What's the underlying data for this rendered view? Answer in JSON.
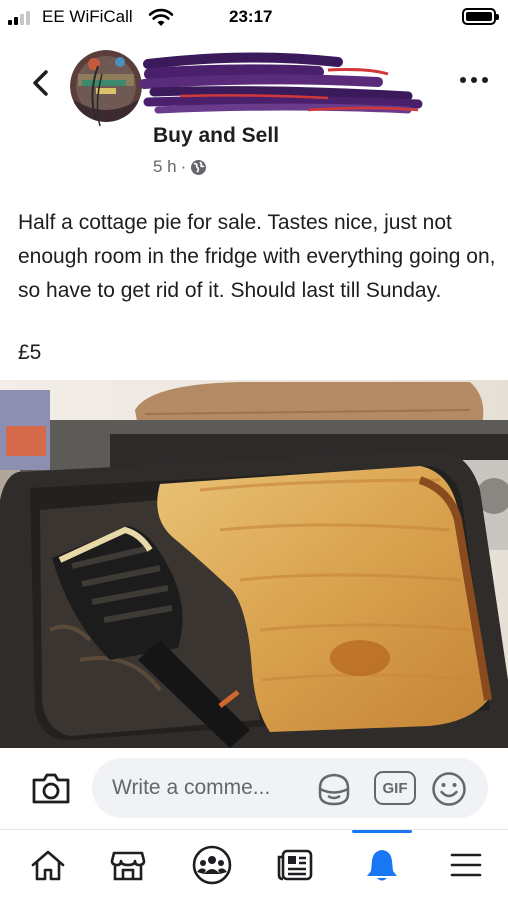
{
  "status_bar": {
    "carrier": "EE WiFiCall",
    "time": "23:17"
  },
  "post": {
    "group_name": "Buy and Sell",
    "timestamp": "5 h",
    "separator": "·",
    "privacy_icon": "globe-icon",
    "text": "Half a cottage pie for sale. Tastes nice, just not enough room in the fridge with everything going on, so have to get rid of it. Should last till Sunday.",
    "price": "£5"
  },
  "comment_bar": {
    "placeholder": "Write a comme...",
    "gif_label": "GIF"
  },
  "bottom_nav": {
    "items": [
      {
        "icon": "home-icon",
        "active": false
      },
      {
        "icon": "marketplace-icon",
        "active": false
      },
      {
        "icon": "groups-icon",
        "active": false
      },
      {
        "icon": "news-icon",
        "active": false
      },
      {
        "icon": "bell-icon",
        "active": true
      },
      {
        "icon": "menu-icon",
        "active": false
      }
    ]
  },
  "colors": {
    "accent": "#1877f2",
    "secondary_text": "#65676b",
    "comment_bg": "#f0f2f5",
    "redaction": "#4a1f6b"
  }
}
